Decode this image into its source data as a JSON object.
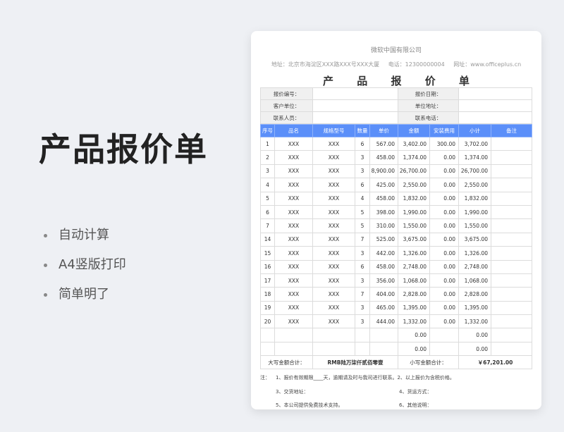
{
  "hero": {
    "title": "产品报价单"
  },
  "features": [
    "自动计算",
    "A4竖版打印",
    "简单明了"
  ],
  "doc": {
    "company": "微软中国有限公司",
    "address": "地址：北京市海淀区XXX路XXX号XXX大厦",
    "phone": "电话：12300000004",
    "website": "网址：www.officeplus.cn",
    "title": "产 品 报 价 单",
    "info": {
      "quote_no": "报价编号：",
      "quote_date": "报价日期：",
      "customer": "客户单位：",
      "unit_address": "单位地址：",
      "contact_person": "联系人员：",
      "contact_phone": "联系电话："
    },
    "headers": [
      "序号",
      "品名",
      "规格型号",
      "数量",
      "单价",
      "金额",
      "安装费用",
      "小计",
      "备注"
    ],
    "rows": [
      [
        "1",
        "XXX",
        "XXX",
        "6",
        "567.00",
        "3,402.00",
        "300.00",
        "3,702.00",
        ""
      ],
      [
        "2",
        "XXX",
        "XXX",
        "3",
        "458.00",
        "1,374.00",
        "0.00",
        "1,374.00",
        ""
      ],
      [
        "3",
        "XXX",
        "XXX",
        "3",
        "8,900.00",
        "26,700.00",
        "0.00",
        "26,700.00",
        ""
      ],
      [
        "4",
        "XXX",
        "XXX",
        "6",
        "425.00",
        "2,550.00",
        "0.00",
        "2,550.00",
        ""
      ],
      [
        "5",
        "XXX",
        "XXX",
        "4",
        "458.00",
        "1,832.00",
        "0.00",
        "1,832.00",
        ""
      ],
      [
        "6",
        "XXX",
        "XXX",
        "5",
        "398.00",
        "1,990.00",
        "0.00",
        "1,990.00",
        ""
      ],
      [
        "7",
        "XXX",
        "XXX",
        "5",
        "310.00",
        "1,550.00",
        "0.00",
        "1,550.00",
        ""
      ],
      [
        "14",
        "XXX",
        "XXX",
        "7",
        "525.00",
        "3,675.00",
        "0.00",
        "3,675.00",
        ""
      ],
      [
        "15",
        "XXX",
        "XXX",
        "3",
        "442.00",
        "1,326.00",
        "0.00",
        "1,326.00",
        ""
      ],
      [
        "16",
        "XXX",
        "XXX",
        "6",
        "458.00",
        "2,748.00",
        "0.00",
        "2,748.00",
        ""
      ],
      [
        "17",
        "XXX",
        "XXX",
        "3",
        "356.00",
        "1,068.00",
        "0.00",
        "1,068.00",
        ""
      ],
      [
        "18",
        "XXX",
        "XXX",
        "7",
        "404.00",
        "2,828.00",
        "0.00",
        "2,828.00",
        ""
      ],
      [
        "19",
        "XXX",
        "XXX",
        "3",
        "465.00",
        "1,395.00",
        "0.00",
        "1,395.00",
        ""
      ],
      [
        "20",
        "XXX",
        "XXX",
        "3",
        "444.00",
        "1,332.00",
        "0.00",
        "1,332.00",
        ""
      ],
      [
        "",
        "",
        "",
        "",
        "",
        "0.00",
        "",
        "0.00",
        ""
      ],
      [
        "",
        "",
        "",
        "",
        "",
        "0.00",
        "",
        "0.00",
        ""
      ]
    ],
    "total": {
      "upper_label": "大写金额合计：",
      "upper_value": "RMB陆万柒仟贰佰零壹",
      "lower_label": "小写金额合计：",
      "lower_value": "￥67,201.00"
    },
    "notes": {
      "label": "注：",
      "n1": "1、报价有效期限____天，逾期请及时与我司进行联系。2、以上报价为含税价格。",
      "n3": "3、交货地址：",
      "n4": "4、货运方式：",
      "n5": "5、本公司提供免费技术支持。",
      "n6": "6、其他说明："
    }
  },
  "colors": {
    "header_blue": "#5b8ff9",
    "background": "#eef0f4"
  }
}
